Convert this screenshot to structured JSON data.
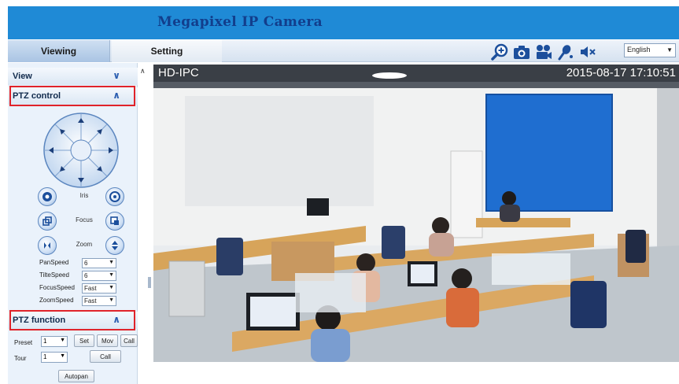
{
  "header": {
    "title": "Megapixel IP Camera"
  },
  "tabs": [
    {
      "label": "Viewing"
    },
    {
      "label": "Setting"
    }
  ],
  "toolbar": {
    "icons": [
      "zoom-in-icon",
      "camera-icon",
      "record-icon",
      "microphone-icon",
      "mute-icon"
    ],
    "language": "English"
  },
  "sidebar": {
    "view_label": "View",
    "ptz_control_label": "PTZ control",
    "iris_label": "Iris",
    "focus_label": "Focus",
    "zoom_label": "Zoom",
    "speeds": [
      {
        "label": "PanSpeed",
        "value": "6"
      },
      {
        "label": "TilteSpeed",
        "value": "6"
      },
      {
        "label": "FocusSpeed",
        "value": "Fast"
      },
      {
        "label": "ZoomSpeed",
        "value": "Fast"
      }
    ],
    "ptz_function_label": "PTZ function",
    "preset_label": "Preset",
    "preset_value": "1",
    "set_label": "Set",
    "mov_label": "Mov",
    "call_label": "Call",
    "tour_label": "Tour",
    "tour_value": "1",
    "tour_call_label": "Call",
    "autopan_label": "Autopan"
  },
  "video": {
    "osd_name": "HD-IPC",
    "osd_datetime": "2015-08-17  17:10:51"
  },
  "colors": {
    "header_blue": "#1f8ad6",
    "title_blue": "#123e8c",
    "highlight_red": "#e0232a",
    "sidebar_bg": "#eaf2fb"
  }
}
